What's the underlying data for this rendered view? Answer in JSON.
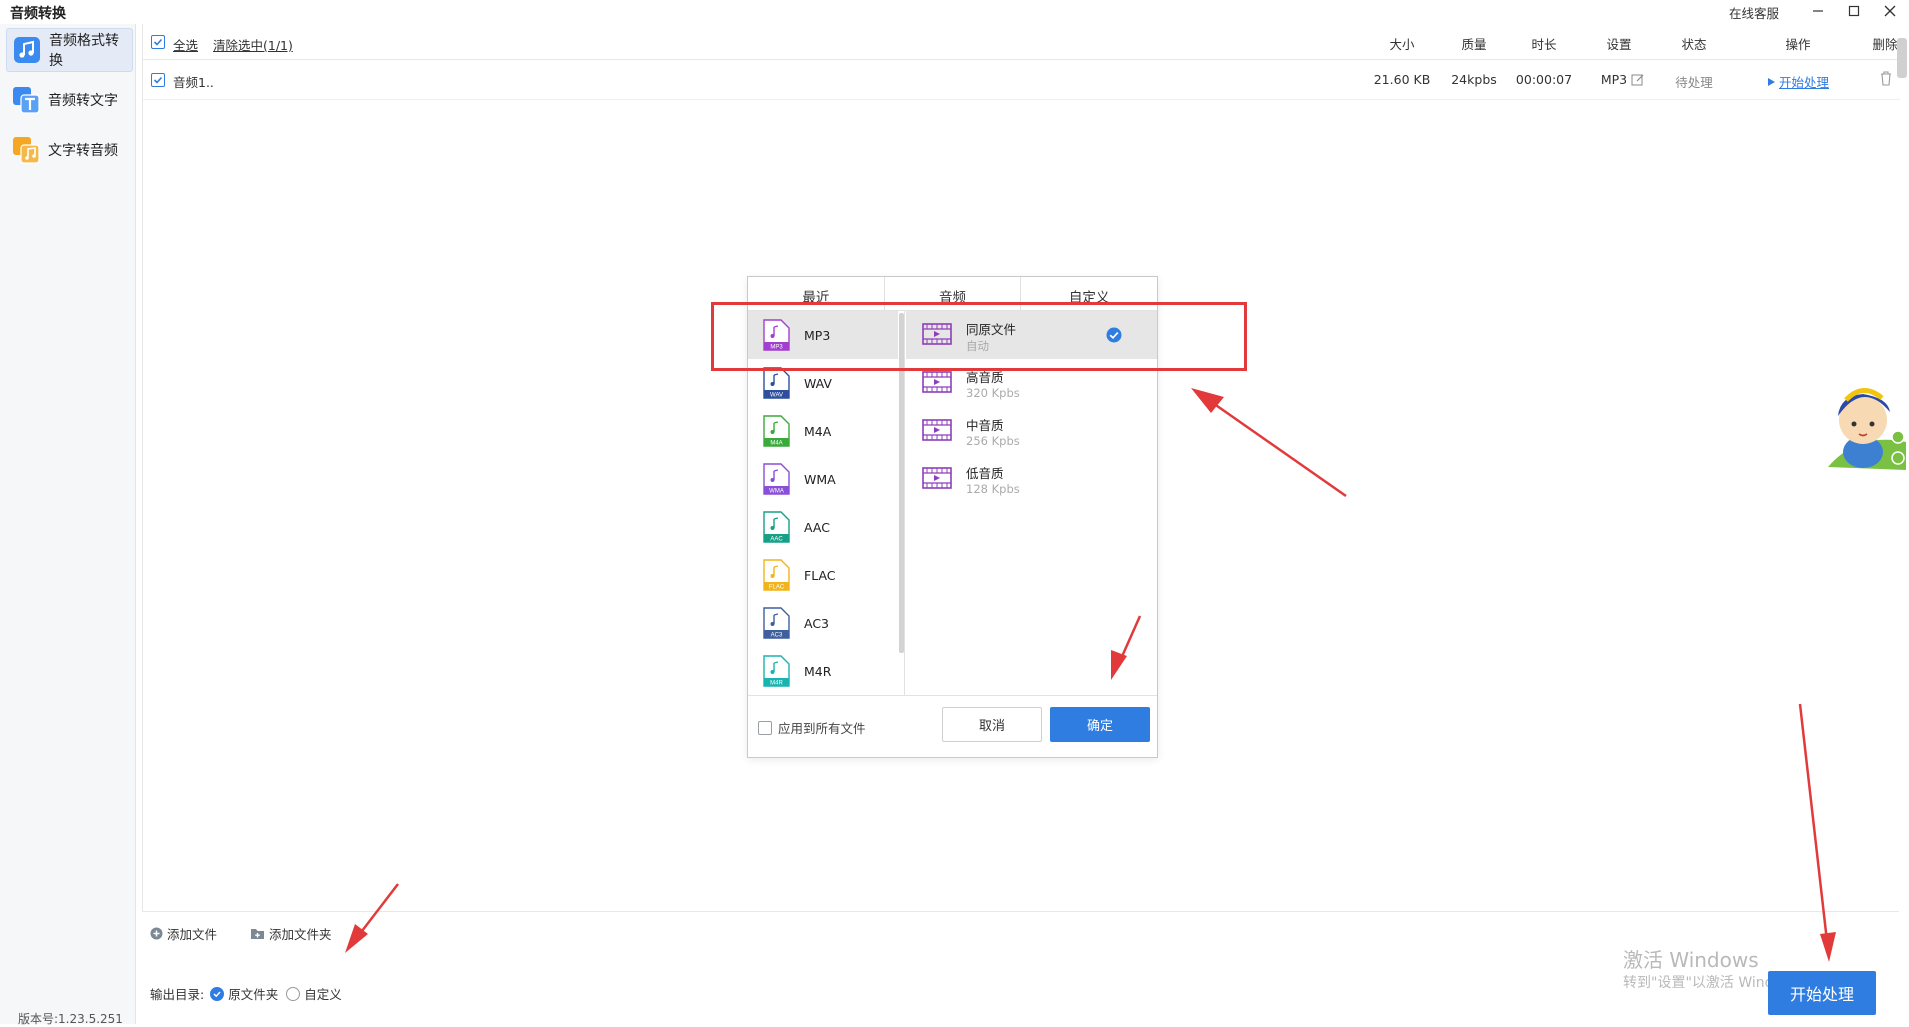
{
  "app": {
    "title": "音频转换",
    "online_service": "在线客服",
    "version": "版本号:1.23.5.251"
  },
  "sidebar": {
    "items": [
      {
        "label": "音频格式转换",
        "icon": "music-note-icon",
        "active": true
      },
      {
        "label": "音频转文字",
        "icon": "text-t-icon",
        "active": false
      },
      {
        "label": "文字转音频",
        "icon": "audio-doc-icon",
        "active": false
      }
    ]
  },
  "list": {
    "select_all": "全选",
    "clear_selected": "清除选中(1/1)",
    "columns": {
      "size": "大小",
      "quality": "质量",
      "duration": "时长",
      "settings": "设置",
      "status": "状态",
      "action": "操作",
      "delete": "删除"
    },
    "rows": [
      {
        "name": "音频1..",
        "size": "21.60 KB",
        "quality": "24kpbs",
        "duration": "00:00:07",
        "format": "MP3",
        "status": "待处理",
        "action": "开始处理"
      }
    ]
  },
  "bottom": {
    "add_file": "添加文件",
    "add_folder": "添加文件夹",
    "output_label": "输出目录:",
    "output_original": "原文件夹",
    "output_custom": "自定义",
    "start_button": "开始处理"
  },
  "watermark": {
    "line1": "激活 Windows",
    "line2": "转到\"设置\"以激活 Windows。"
  },
  "dialog": {
    "tabs": [
      "最近",
      "音频",
      "自定义"
    ],
    "formats": [
      {
        "label": "MP3",
        "color": "#a23fcf",
        "selected": true
      },
      {
        "label": "WAV",
        "color": "#2d4f9e",
        "selected": false
      },
      {
        "label": "M4A",
        "color": "#3aaa3a",
        "selected": false
      },
      {
        "label": "WMA",
        "color": "#8a4fd8",
        "selected": false
      },
      {
        "label": "AAC",
        "color": "#17a088",
        "selected": false
      },
      {
        "label": "FLAC",
        "color": "#f2b41b",
        "selected": false
      },
      {
        "label": "AC3",
        "color": "#3f5f9f",
        "selected": false
      },
      {
        "label": "M4R",
        "color": "#19b4b0",
        "selected": false
      }
    ],
    "qualities": [
      {
        "name": "同原文件",
        "sub": "自动",
        "selected": true
      },
      {
        "name": "高音质",
        "sub": "320 Kpbs",
        "selected": false
      },
      {
        "name": "中音质",
        "sub": "256 Kpbs",
        "selected": false
      },
      {
        "name": "低音质",
        "sub": "128 Kpbs",
        "selected": false
      }
    ],
    "apply_all": "应用到所有文件",
    "cancel": "取消",
    "ok": "确定"
  },
  "colors": {
    "accent": "#2f7de1",
    "annotation": "#e23a3a"
  }
}
